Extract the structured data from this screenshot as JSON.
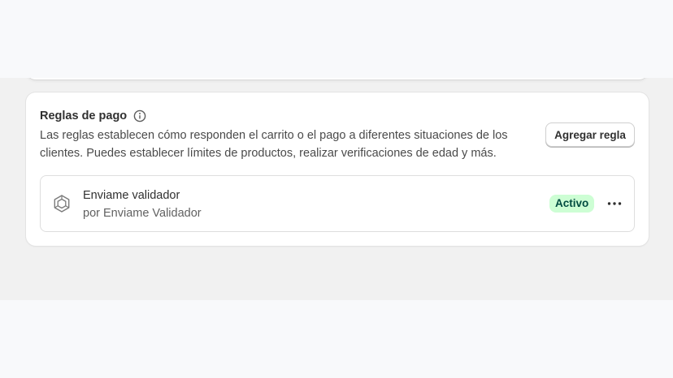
{
  "payment_rules": {
    "title": "Reglas de pago",
    "title_icon": "info-icon",
    "description": "Las reglas establecen cómo responden el carrito o el pago a diferentes situaciones de los clientes. Puedes establecer límites de productos, realizar verificaciones de edad y más.",
    "add_button_label": "Agregar regla",
    "rules": [
      {
        "icon": "hexagon-app-icon",
        "name": "Enviame validador",
        "provider": "por Enviame Validador",
        "status": "Activo",
        "more_icon": "horizontal-dots-icon"
      }
    ]
  },
  "colors": {
    "status_active_bg": "#cdfed4",
    "status_active_text": "#014b40",
    "page_background": "#f1f1f1",
    "card_background": "#ffffff"
  }
}
